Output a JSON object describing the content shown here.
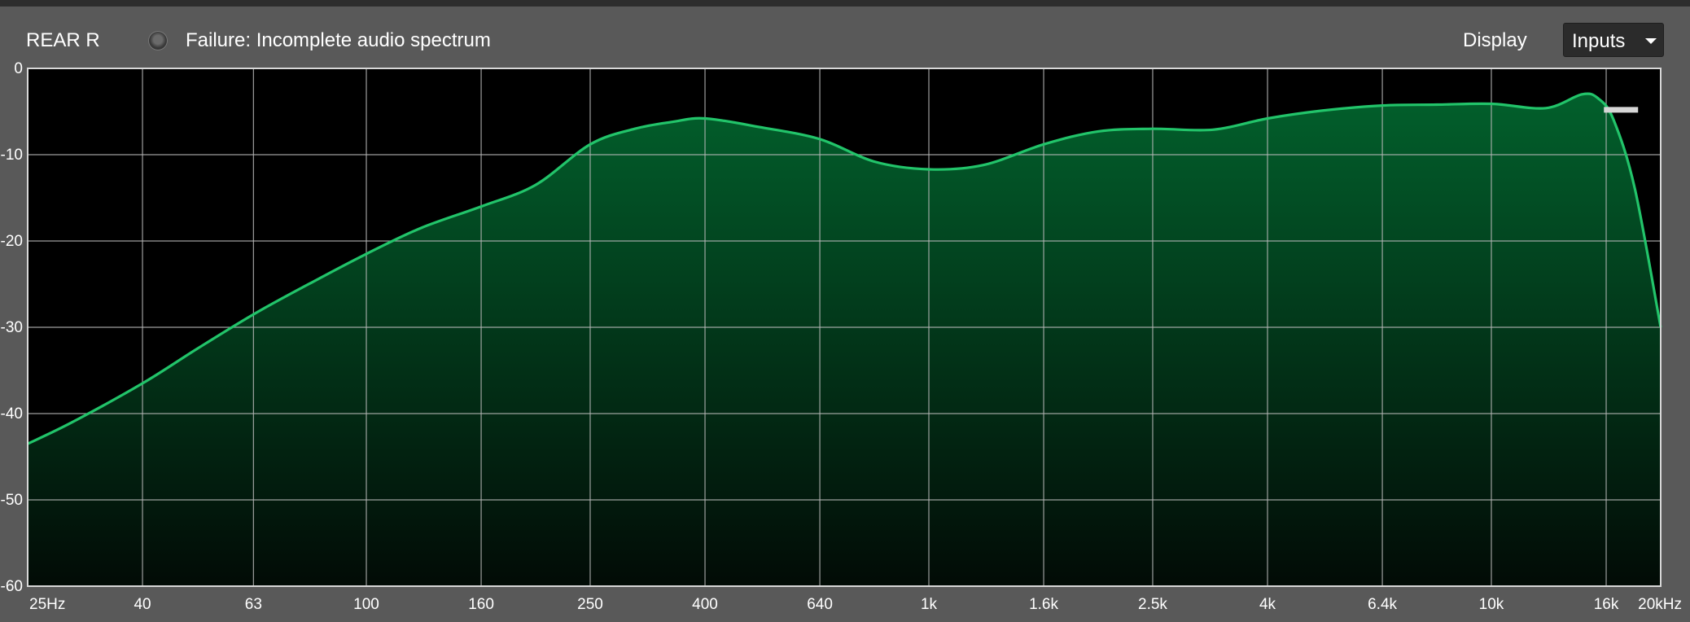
{
  "header": {
    "channel": "REAR R",
    "status": "Failure: Incomplete audio spectrum",
    "display_label": "Display",
    "display_value": "Inputs"
  },
  "colors": {
    "curve": "#22c46a",
    "fill_top": "#02602c",
    "fill_bottom": "#020b06",
    "grid": "#b8b8b8",
    "plot_background": "#000000"
  },
  "icons": {
    "status_led": "radio-indicator-icon",
    "dropdown": "caret-down-icon"
  },
  "chart_data": {
    "type": "area",
    "title": "",
    "xlabel": "",
    "ylabel": "",
    "x_scale": "log",
    "xlim": [
      25,
      20000
    ],
    "ylim": [
      0,
      -60
    ],
    "grid": true,
    "x_tick_labels": [
      "25Hz",
      "40",
      "63",
      "100",
      "160",
      "250",
      "400",
      "640",
      "1k",
      "1.6k",
      "2.5k",
      "4k",
      "6.4k",
      "10k",
      "16k",
      "20kHz"
    ],
    "y_tick_labels": [
      "0",
      "-10",
      "-20",
      "-30",
      "-40",
      "-50",
      "-60"
    ],
    "y_tick_values": [
      0,
      -10,
      -20,
      -30,
      -40,
      -50,
      -60
    ],
    "series": [
      {
        "x": [
          25,
          30,
          40,
          50,
          63,
          80,
          100,
          125,
          160,
          200,
          250,
          300,
          350,
          400,
          500,
          640,
          800,
          1000,
          1250,
          1600,
          2000,
          2500,
          3200,
          4000,
          5000,
          6400,
          8000,
          10000,
          12500,
          14500,
          15500,
          16500,
          18000,
          20000
        ],
        "y": [
          -43.5,
          -41,
          -36.5,
          -32.5,
          -28.5,
          -24.8,
          -21.5,
          -18.5,
          -16,
          -13.5,
          -8.8,
          -7,
          -6.2,
          -5.8,
          -6.8,
          -8.2,
          -10.8,
          -11.7,
          -11.2,
          -8.8,
          -7.3,
          -7,
          -7.1,
          -5.8,
          -4.9,
          -4.3,
          -4.2,
          -4.1,
          -4.6,
          -3,
          -3.5,
          -6,
          -14,
          -30
        ]
      }
    ],
    "marker": {
      "x": 17000,
      "y": -4.8
    }
  }
}
